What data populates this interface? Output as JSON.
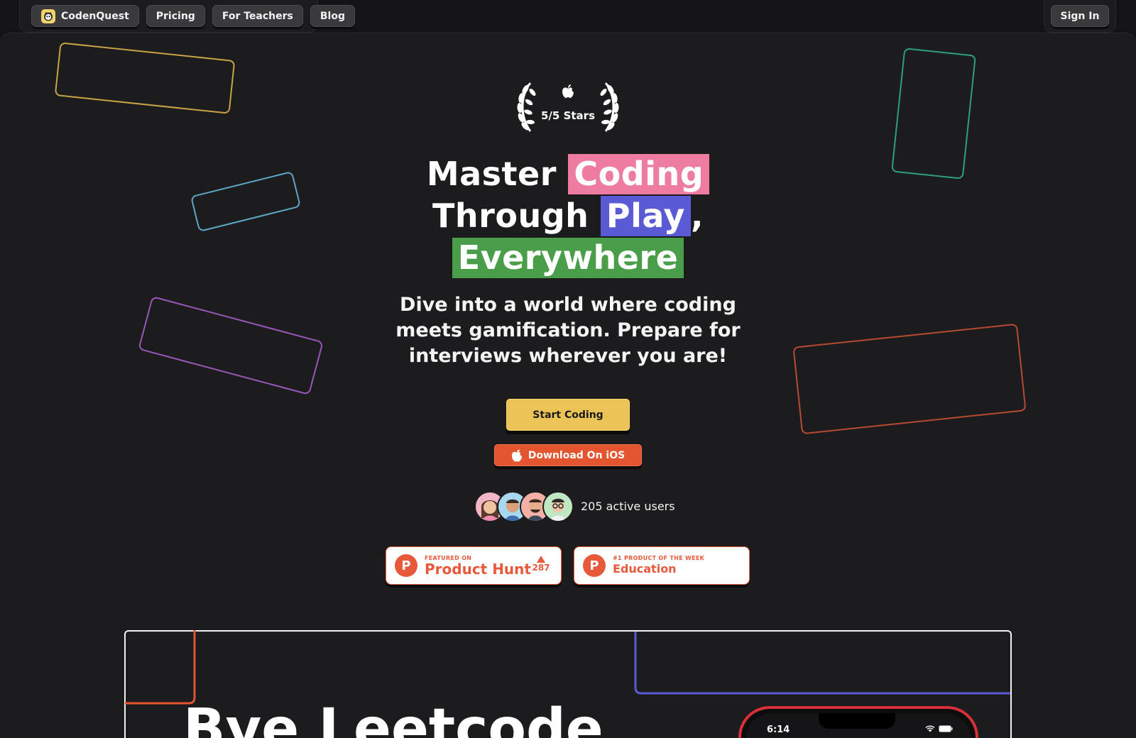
{
  "nav": {
    "brand": "CodenQuest",
    "links": [
      "Pricing",
      "For Teachers",
      "Blog"
    ],
    "sign_in": "Sign In"
  },
  "award": {
    "rating_text": "5/5 Stars",
    "icon": "apple-icon"
  },
  "hero": {
    "headline_word_1": "Master",
    "headline_highlight_1": "Coding",
    "headline_word_2": "Through",
    "headline_highlight_2": "Play",
    "headline_comma": ",",
    "headline_highlight_3": "Everywhere",
    "subtitle": "Dive into a world where coding meets gamification. Prepare for interviews wherever you are!"
  },
  "cta": {
    "start_label": "Start Coding",
    "ios_label": "Download On iOS"
  },
  "users": {
    "count_text": "205 active users"
  },
  "badges": {
    "product_hunt_small": "FEATURED ON",
    "product_hunt_big": "Product Hunt",
    "product_hunt_votes": "287",
    "week_small": "#1 PRODUCT OF THE WEEK",
    "week_big": "Education",
    "logo_letter": "P"
  },
  "lower": {
    "heading_partial": "Bye Leetcode",
    "phone_time": "6:14"
  },
  "colors": {
    "accent_yellow": "#ecc356",
    "accent_orange": "#e2552e",
    "highlight_pink": "#ee7ba0",
    "highlight_blue": "#5a5bd4",
    "highlight_green": "#4a9e49",
    "background": "#1c1c1e"
  }
}
